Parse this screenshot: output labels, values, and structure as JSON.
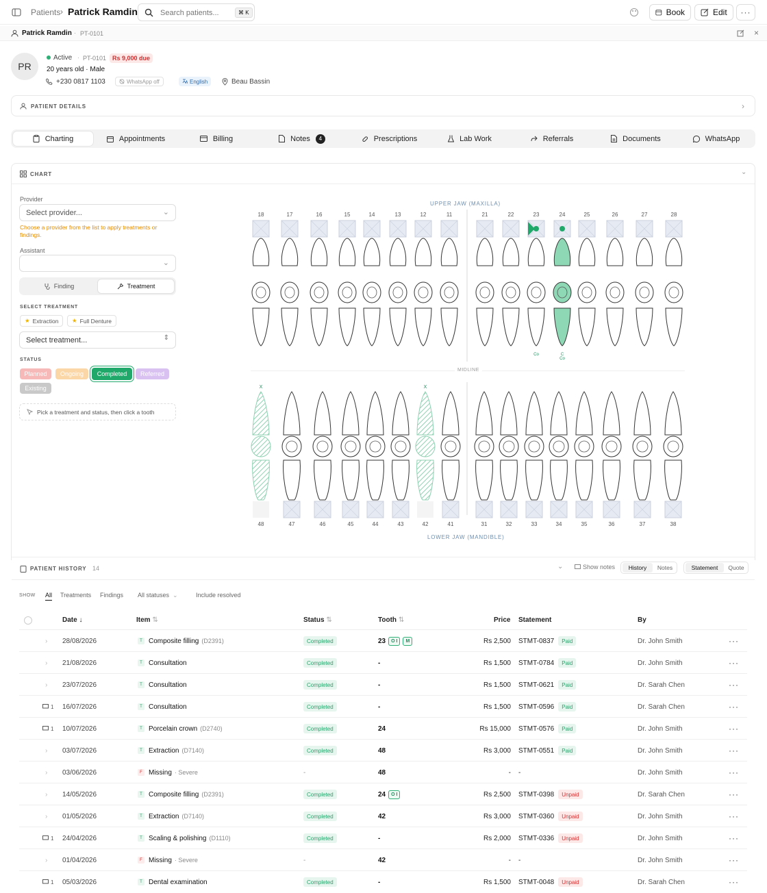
{
  "topbar": {
    "crumb_parent": "Patients",
    "crumb_current": "Patrick Ramdin",
    "search_placeholder": "Search patients...",
    "search_shortcut": "⌘ K",
    "book_label": "Book",
    "edit_label": "Edit"
  },
  "subbar": {
    "name": "Patrick Ramdin",
    "id": "PT-0101"
  },
  "patient": {
    "initials": "PR",
    "status": "Active",
    "id": "PT-0101",
    "due": "Rs 9,000 due",
    "age_sex": "20 years old · Male",
    "phone": "+230 0817 1103",
    "whatsapp": "WhatsApp off",
    "language": "English",
    "location": "Beau Bassin",
    "details_label": "PATIENT DETAILS"
  },
  "tabs": [
    {
      "label": "Charting"
    },
    {
      "label": "Appointments"
    },
    {
      "label": "Billing"
    },
    {
      "label": "Notes",
      "count": "4"
    },
    {
      "label": "Prescriptions"
    },
    {
      "label": "Lab Work"
    },
    {
      "label": "Referrals"
    },
    {
      "label": "Documents"
    },
    {
      "label": "WhatsApp"
    }
  ],
  "chart": {
    "section_label": "CHART",
    "provider_label": "Provider",
    "provider_placeholder": "Select provider...",
    "provider_hint": "Choose a provider from the list to apply treatments or findings.",
    "assistant_label": "Assistant",
    "mode_finding": "Finding",
    "mode_treatment": "Treatment",
    "select_treatment_label": "SELECT TREATMENT",
    "chip_extraction": "Extraction",
    "chip_denture": "Full Denture",
    "treatment_placeholder": "Select treatment...",
    "status_label": "STATUS",
    "statuses": [
      "Planned",
      "Ongoing",
      "Completed",
      "Referred",
      "Existing"
    ],
    "hint": "Pick a treatment and status, then click a tooth",
    "upper_jaw": "UPPER JAW (MAXILLA)",
    "lower_jaw": "LOWER JAW (MANDIBLE)",
    "midline": "MIDLINE",
    "upper_numbers": [
      "18",
      "17",
      "16",
      "15",
      "14",
      "13",
      "12",
      "11",
      "21",
      "22",
      "23",
      "24",
      "25",
      "26",
      "27",
      "28"
    ],
    "lower_numbers": [
      "48",
      "47",
      "46",
      "45",
      "44",
      "43",
      "42",
      "41",
      "31",
      "32",
      "33",
      "34",
      "35",
      "36",
      "37",
      "38"
    ],
    "upper_markers": {
      "23": "Co",
      "24": "C\nCo"
    },
    "lower_marks": {
      "48": "X",
      "42": "X"
    }
  },
  "history": {
    "title": "PATIENT HISTORY",
    "count": "14",
    "show_notes": "Show notes",
    "toggle_history": "History",
    "toggle_notes": "Notes",
    "toggle_statement": "Statement",
    "toggle_quote": "Quote",
    "show_label": "SHOW",
    "filter_all": "All",
    "filter_treatments": "Treatments",
    "filter_findings": "Findings",
    "all_statuses": "All statuses",
    "include_resolved": "Include resolved",
    "columns": {
      "date": "Date",
      "item": "Item",
      "status": "Status",
      "tooth": "Tooth",
      "price": "Price",
      "statement": "Statement",
      "by": "By"
    },
    "rows": [
      {
        "notes": "",
        "date": "28/08/2026",
        "type": "T",
        "item": "Composite filling",
        "code": "(D2391)",
        "status": "Completed",
        "tooth": "23",
        "tags": [
          "O I",
          "M"
        ],
        "price": "Rs 2,500",
        "stmt": "STMT-0837",
        "pay": "Paid",
        "by": "Dr. John Smith"
      },
      {
        "notes": "",
        "date": "21/08/2026",
        "type": "T",
        "item": "Consultation",
        "code": "",
        "status": "Completed",
        "tooth": "-",
        "tags": [],
        "price": "Rs 1,500",
        "stmt": "STMT-0784",
        "pay": "Paid",
        "by": "Dr. John Smith"
      },
      {
        "notes": "",
        "date": "23/07/2026",
        "type": "T",
        "item": "Consultation",
        "code": "",
        "status": "Completed",
        "tooth": "-",
        "tags": [],
        "price": "Rs 1,500",
        "stmt": "STMT-0621",
        "pay": "Paid",
        "by": "Dr. Sarah Chen"
      },
      {
        "notes": "1",
        "date": "16/07/2026",
        "type": "T",
        "item": "Consultation",
        "code": "",
        "status": "Completed",
        "tooth": "-",
        "tags": [],
        "price": "Rs 1,500",
        "stmt": "STMT-0596",
        "pay": "Paid",
        "by": "Dr. Sarah Chen"
      },
      {
        "notes": "1",
        "date": "10/07/2026",
        "type": "T",
        "item": "Porcelain crown",
        "code": "(D2740)",
        "status": "Completed",
        "tooth": "24",
        "tags": [],
        "price": "Rs 15,000",
        "stmt": "STMT-0576",
        "pay": "Paid",
        "by": "Dr. John Smith"
      },
      {
        "notes": "",
        "date": "03/07/2026",
        "type": "T",
        "item": "Extraction",
        "code": "(D7140)",
        "status": "Completed",
        "tooth": "48",
        "tags": [],
        "price": "Rs 3,000",
        "stmt": "STMT-0551",
        "pay": "Paid",
        "by": "Dr. John Smith"
      },
      {
        "notes": "",
        "date": "03/06/2026",
        "type": "F",
        "item": "Missing",
        "code": "· Severe",
        "status": "-",
        "tooth": "48",
        "tags": [],
        "price": "-",
        "stmt": "-",
        "pay": "",
        "by": "Dr. John Smith"
      },
      {
        "notes": "",
        "date": "14/05/2026",
        "type": "T",
        "item": "Composite filling",
        "code": "(D2391)",
        "status": "Completed",
        "tooth": "24",
        "tags": [
          "O I"
        ],
        "price": "Rs 2,500",
        "stmt": "STMT-0398",
        "pay": "Unpaid",
        "by": "Dr. Sarah Chen"
      },
      {
        "notes": "",
        "date": "01/05/2026",
        "type": "T",
        "item": "Extraction",
        "code": "(D7140)",
        "status": "Completed",
        "tooth": "42",
        "tags": [],
        "price": "Rs 3,000",
        "stmt": "STMT-0360",
        "pay": "Unpaid",
        "by": "Dr. John Smith"
      },
      {
        "notes": "1",
        "date": "24/04/2026",
        "type": "T",
        "item": "Scaling & polishing",
        "code": "(D1110)",
        "status": "Completed",
        "tooth": "-",
        "tags": [],
        "price": "Rs 2,000",
        "stmt": "STMT-0336",
        "pay": "Unpaid",
        "by": "Dr. John Smith"
      },
      {
        "notes": "",
        "date": "01/04/2026",
        "type": "F",
        "item": "Missing",
        "code": "· Severe",
        "status": "-",
        "tooth": "42",
        "tags": [],
        "price": "-",
        "stmt": "-",
        "pay": "",
        "by": "Dr. John Smith"
      },
      {
        "notes": "1",
        "date": "05/03/2026",
        "type": "T",
        "item": "Dental examination",
        "code": "",
        "status": "Completed",
        "tooth": "-",
        "tags": [],
        "price": "Rs 1,500",
        "stmt": "STMT-0048",
        "pay": "Unpaid",
        "by": "Dr. Sarah Chen"
      }
    ]
  },
  "colors": {
    "accent_green": "#2fae75",
    "due_red": "#d32f2f",
    "paid_green": "#25a26a",
    "missing_hatch": "#8fd1b2"
  }
}
